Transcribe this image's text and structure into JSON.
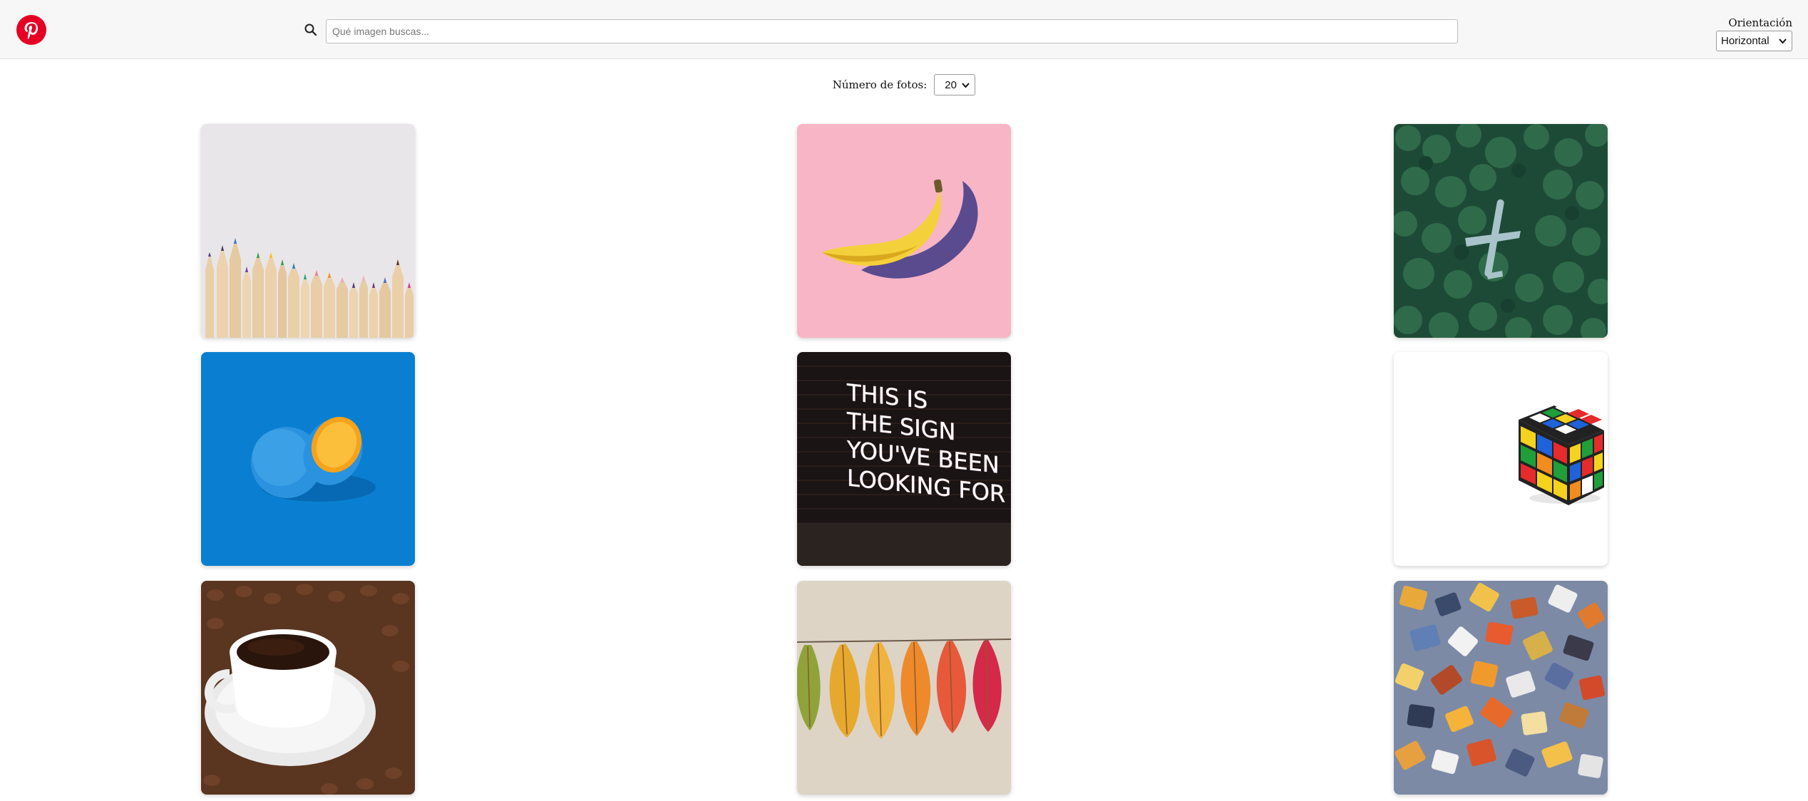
{
  "header": {
    "logo_icon": "pinterest-logo-icon",
    "search": {
      "icon": "search-icon",
      "placeholder": "Qué imagen buscas...",
      "value": ""
    },
    "orientation": {
      "label": "Orientación",
      "selected": "Horizontal",
      "options": [
        "Horizontal"
      ]
    }
  },
  "controls": {
    "count_label": "Número de fotos:",
    "count_selected": "20"
  },
  "colors": {
    "brand": "#e60023",
    "header_bg": "#f7f7f7"
  },
  "gallery": {
    "photos": [
      {
        "subject": "colored-pencils"
      },
      {
        "subject": "banana"
      },
      {
        "subject": "airplane-in-forest"
      },
      {
        "subject": "blue-orange"
      },
      {
        "subject": "neon-sign"
      },
      {
        "subject": "rubiks-cube"
      },
      {
        "subject": "coffee-cup"
      },
      {
        "subject": "autumn-leaves"
      },
      {
        "subject": "puzzle-pieces"
      }
    ],
    "neon_text": [
      "THIS IS",
      "THE SIGN",
      "YOU'VE BEEN",
      "LOOKING FOR"
    ]
  }
}
